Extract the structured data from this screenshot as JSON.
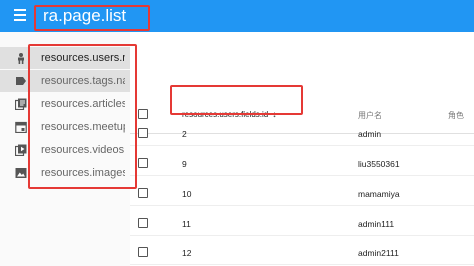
{
  "app": {
    "title": "ra.page.list"
  },
  "sidebar": {
    "items": [
      {
        "label": "resources.users.name",
        "icon": "person-icon",
        "selected": true
      },
      {
        "label": "resources.tags.name",
        "icon": "label-icon",
        "selected": false
      },
      {
        "label": "resources.articles.name",
        "icon": "library-books-icon",
        "selected": false
      },
      {
        "label": "resources.meetups.name",
        "icon": "event-icon",
        "selected": false
      },
      {
        "label": "resources.videos.name",
        "icon": "video-library-icon",
        "selected": false
      },
      {
        "label": "resources.images.name",
        "icon": "image-icon",
        "selected": false
      }
    ]
  },
  "table": {
    "columns": [
      {
        "label": "resources.users.fields.id",
        "sorted": true,
        "sort_icon": "arrow-downward-icon"
      },
      {
        "label": "用户名"
      },
      {
        "label": "角色"
      }
    ],
    "rows": [
      {
        "id": "2",
        "username": "admin"
      },
      {
        "id": "9",
        "username": "liu3550361"
      },
      {
        "id": "10",
        "username": "mamamiya"
      },
      {
        "id": "11",
        "username": "admin111"
      },
      {
        "id": "12",
        "username": "admin2111"
      }
    ]
  },
  "colors": {
    "appbar": "#2196f3",
    "highlight": "#e53935",
    "selected_bg": "#e0e0e0"
  }
}
